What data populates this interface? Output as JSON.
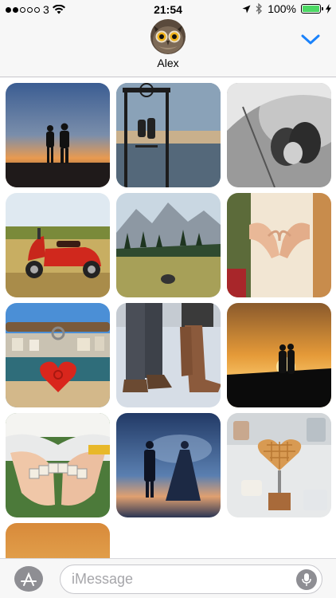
{
  "status_bar": {
    "carrier": "3",
    "signal_bars": 2,
    "time": "21:54",
    "battery_percent": "100%",
    "battery_level": 1.0,
    "battery_color": "#4cd964"
  },
  "conversation": {
    "contact_name": "Alex",
    "avatar_icon": "owl-avatar",
    "collapse_icon": "chevron-down-icon",
    "accent_color": "#1a82fb"
  },
  "photos": [
    {
      "label": "couple-silhouette-sunset"
    },
    {
      "label": "couple-swing-ocean"
    },
    {
      "label": "couple-umbrella-rain"
    },
    {
      "label": "red-scooter-field"
    },
    {
      "label": "mountain-meadow"
    },
    {
      "label": "hands-heart-shape"
    },
    {
      "label": "heart-padlock-beach"
    },
    {
      "label": "boots-in-snow"
    },
    {
      "label": "couple-kiss-sunset"
    },
    {
      "label": "forever-letter-tiles"
    },
    {
      "label": "wedding-couple-dusk"
    },
    {
      "label": "heart-waffle-cafe"
    },
    {
      "label": "sunset-partial"
    }
  ],
  "composer": {
    "placeholder": "iMessage",
    "app_store_icon": "app-store-icon",
    "mic_icon": "microphone-icon"
  }
}
